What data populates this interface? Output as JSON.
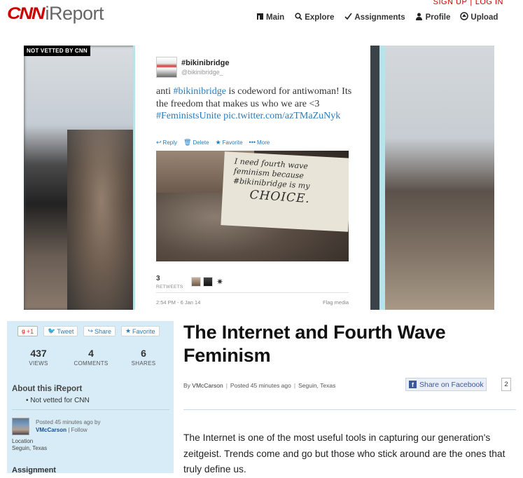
{
  "header": {
    "logo_cnn": "CNN",
    "logo_ireport": "iReport",
    "sign_up": "SIGN UP",
    "log_in": "LOG IN",
    "nav": [
      {
        "label": "Main",
        "icon": "home-icon"
      },
      {
        "label": "Explore",
        "icon": "search-icon"
      },
      {
        "label": "Assignments",
        "icon": "check-icon"
      },
      {
        "label": "Profile",
        "icon": "person-icon"
      },
      {
        "label": "Upload",
        "icon": "upload-icon"
      }
    ]
  },
  "hero": {
    "badge": "NOT VETTED BY CNN",
    "tweet": {
      "name": "#bikinibridge",
      "handle": "@bikinibridge_",
      "text_parts": [
        "anti ",
        "#bikinibridge",
        " is codeword for antiwoman! Its the freedom that makes us who we are <3 ",
        "#FeministsUnite",
        " ",
        "pic.twitter.com/azTMaZuNyk"
      ],
      "actions": [
        "Reply",
        "Delete",
        "Favorite",
        "More"
      ],
      "photo_text": [
        "I need fourth wave",
        "feminism because",
        "#bikinibridge is my",
        "CHOICE."
      ],
      "retweets_count": "3",
      "retweets_label": "RETWEETS",
      "time": "2:54 PM - 6 Jan 14",
      "flag": "Flag media"
    }
  },
  "sidebar": {
    "share_buttons": [
      "+1",
      "Tweet",
      "Share",
      "Favorite"
    ],
    "stats": [
      {
        "value": "437",
        "label": "VIEWS"
      },
      {
        "value": "4",
        "label": "COMMENTS"
      },
      {
        "value": "6",
        "label": "SHARES"
      }
    ],
    "about_heading": "About this iReport",
    "about_item": "Not vetted for CNN",
    "posted_prefix": "Posted 45 minutes ago by",
    "posted_user": "VMcCarson",
    "follow": "Follow",
    "location_label": "Location",
    "location_value": "Seguin, Texas",
    "assignment_heading": "Assignment"
  },
  "article": {
    "title": "The Internet and Fourth Wave Feminism",
    "by": "By",
    "author": "VMcCarson",
    "posted": "Posted 45 minutes ago",
    "location": "Seguin, Texas",
    "fb_share": "Share on Facebook",
    "fb_count": "2",
    "body": "The Internet is one of the most useful tools in capturing our generation's zeitgeist. Trends come and go but those who stick around are the ones that truly define us."
  }
}
